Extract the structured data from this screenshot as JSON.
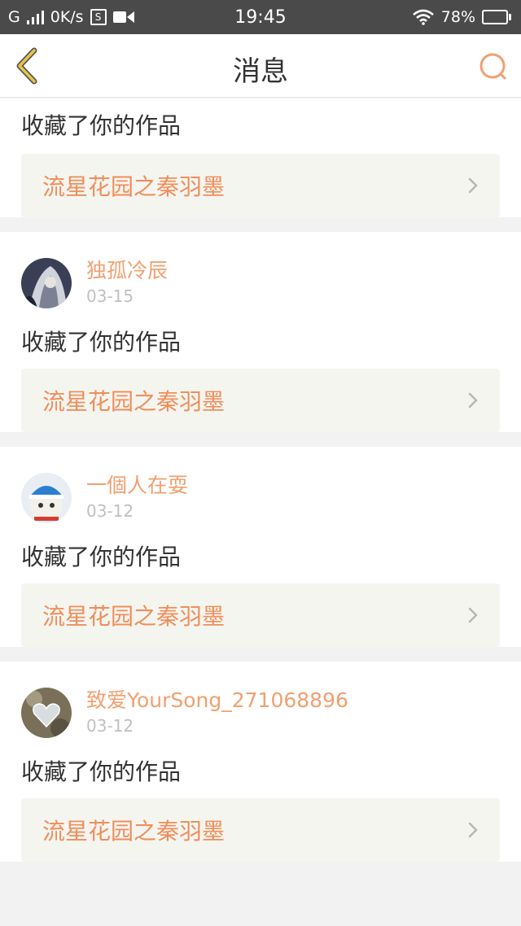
{
  "status_bar": {
    "network": "G",
    "speed": "0K/s",
    "sd_label": "S",
    "time": "19:45",
    "battery": "78%",
    "battery_level": 0.78
  },
  "header": {
    "title": "消息"
  },
  "messages": [
    {
      "action": "收藏了你的作品",
      "work_title": "流星花园之秦羽墨"
    },
    {
      "username": "独孤冷辰",
      "date": "03-15",
      "action": "收藏了你的作品",
      "work_title": "流星花园之秦羽墨",
      "avatar_icon": "anime-avatar-icon"
    },
    {
      "username": "一個人在耍",
      "date": "03-12",
      "action": "收藏了你的作品",
      "work_title": "流星花园之秦羽墨",
      "avatar_icon": "cat-avatar-icon"
    },
    {
      "username": "致爱YourSong_271068896",
      "date": "03-12",
      "action": "收藏了你的作品",
      "work_title": "流星花园之秦羽墨",
      "avatar_icon": "heart-avatar-icon"
    }
  ],
  "colors": {
    "accent": "#f08e5a",
    "username": "#f0a070",
    "back_arrow": "#e6c34a"
  }
}
